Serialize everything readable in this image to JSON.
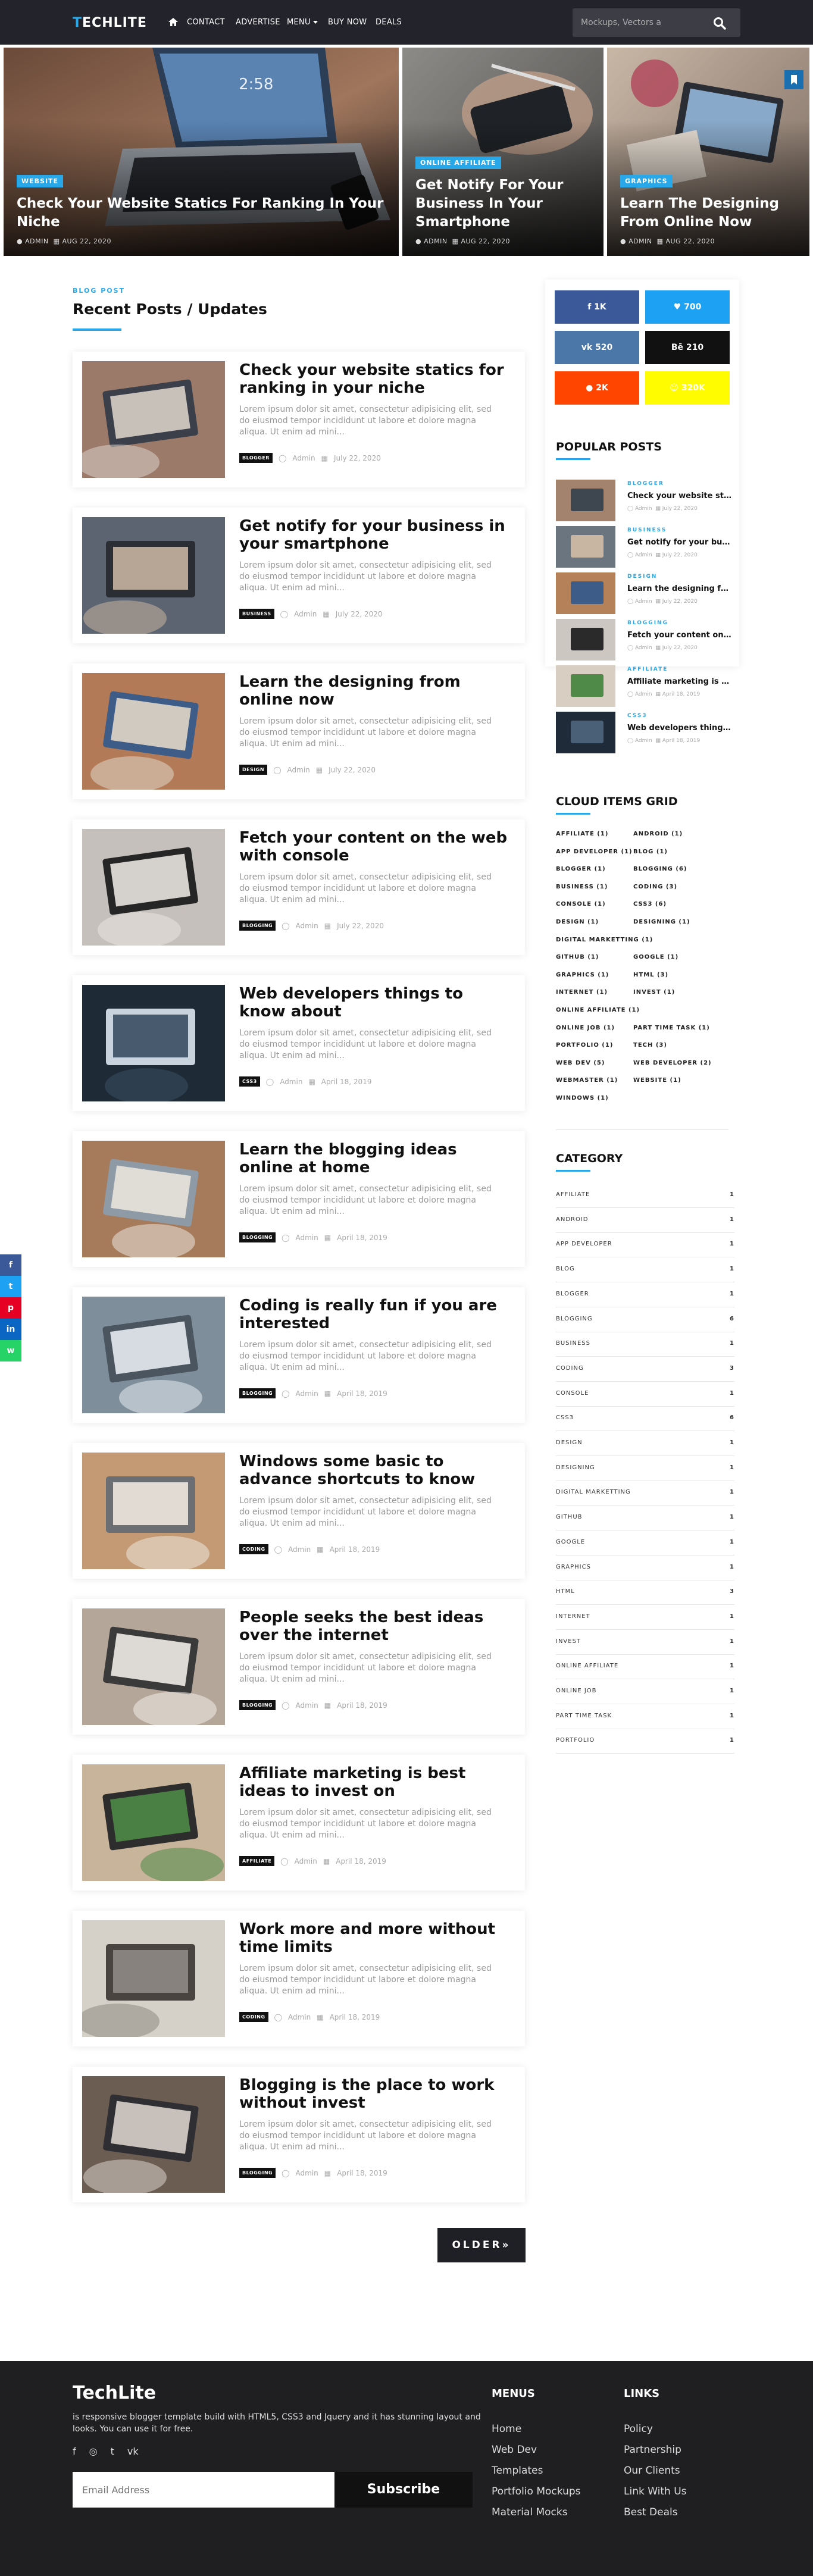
{
  "header": {
    "logo_first": "T",
    "logo_rest": "ECHLITE",
    "nav": [
      "CONTACT",
      "ADVERTISE",
      "MENU",
      "BUY NOW",
      "DEALS"
    ],
    "search_placeholder": "Mockups, Vectors a"
  },
  "hero": [
    {
      "badge": "WEBSITE",
      "title": "Check Your Website Statics For Ranking In Your Niche",
      "author": "ADMIN",
      "date": "AUG 22, 2020"
    },
    {
      "badge": "ONLINE AFFILIATE",
      "title": "Get Notify For Your Business In Your Smartphone",
      "author": "ADMIN",
      "date": "AUG 22, 2020"
    },
    {
      "badge": "GRAPHICS",
      "title": "Learn The Designing From Online Now",
      "author": "ADMIN",
      "date": "AUG 22, 2020"
    }
  ],
  "section": {
    "label": "BLOG POST",
    "title": "Recent Posts / Updates"
  },
  "posts": [
    {
      "title": "Check your website statics for ranking in your niche",
      "excerpt": "Lorem ipsum dolor sit amet, consectetur adipisicing elit, sed do eiusmod tempor incididunt ut labore et dolore magna aliqua. Ut enim ad mini...",
      "tag": "BLOGGER",
      "author": "Admin",
      "date": "July 22, 2020"
    },
    {
      "title": "Get notify for your business in your smartphone",
      "excerpt": "Lorem ipsum dolor sit amet, consectetur adipisicing elit, sed do eiusmod tempor incididunt ut labore et dolore magna aliqua. Ut enim ad mini...",
      "tag": "BUSINESS",
      "author": "Admin",
      "date": "July 22, 2020"
    },
    {
      "title": "Learn the designing from online now",
      "excerpt": "Lorem ipsum dolor sit amet, consectetur adipisicing elit, sed do eiusmod tempor incididunt ut labore et dolore magna aliqua. Ut enim ad mini...",
      "tag": "DESIGN",
      "author": "Admin",
      "date": "July 22, 2020"
    },
    {
      "title": "Fetch your content on the web with console",
      "excerpt": "Lorem ipsum dolor sit amet, consectetur adipisicing elit, sed do eiusmod tempor incididunt ut labore et dolore magna aliqua. Ut enim ad mini...",
      "tag": "BLOGGING",
      "author": "Admin",
      "date": "July 22, 2020"
    },
    {
      "title": "Web developers things to know about",
      "excerpt": "Lorem ipsum dolor sit amet, consectetur adipisicing elit, sed do eiusmod tempor incididunt ut labore et dolore magna aliqua. Ut enim ad mini...",
      "tag": "CSS3",
      "author": "Admin",
      "date": "April 18, 2019"
    },
    {
      "title": "Learn the blogging ideas online at home",
      "excerpt": "Lorem ipsum dolor sit amet, consectetur adipisicing elit, sed do eiusmod tempor incididunt ut labore et dolore magna aliqua. Ut enim ad mini...",
      "tag": "BLOGGING",
      "author": "Admin",
      "date": "April 18, 2019"
    },
    {
      "title": "Coding is really fun if you are interested",
      "excerpt": "Lorem ipsum dolor sit amet, consectetur adipisicing elit, sed do eiusmod tempor incididunt ut labore et dolore magna aliqua. Ut enim ad mini...",
      "tag": "BLOGGING",
      "author": "Admin",
      "date": "April 18, 2019"
    },
    {
      "title": "Windows some basic to advance shortcuts to know",
      "excerpt": "Lorem ipsum dolor sit amet, consectetur adipisicing elit, sed do eiusmod tempor incididunt ut labore et dolore magna aliqua. Ut enim ad mini...",
      "tag": "CODING",
      "author": "Admin",
      "date": "April 18, 2019"
    },
    {
      "title": "People seeks the best ideas over the internet",
      "excerpt": "Lorem ipsum dolor sit amet, consectetur adipisicing elit, sed do eiusmod tempor incididunt ut labore et dolore magna aliqua. Ut enim ad mini...",
      "tag": "BLOGGING",
      "author": "Admin",
      "date": "April 18, 2019"
    },
    {
      "title": "Affiliate marketing is best ideas to invest on",
      "excerpt": "Lorem ipsum dolor sit amet, consectetur adipisicing elit, sed do eiusmod tempor incididunt ut labore et dolore magna aliqua. Ut enim ad mini...",
      "tag": "AFFILIATE",
      "author": "Admin",
      "date": "April 18, 2019"
    },
    {
      "title": "Work more and more without time limits",
      "excerpt": "Lorem ipsum dolor sit amet, consectetur adipisicing elit, sed do eiusmod tempor incididunt ut labore et dolore magna aliqua. Ut enim ad mini...",
      "tag": "CODING",
      "author": "Admin",
      "date": "April 18, 2019"
    },
    {
      "title": "Blogging is the place to work without invest",
      "excerpt": "Lorem ipsum dolor sit amet, consectetur adipisicing elit, sed do eiusmod tempor incididunt ut labore et dolore magna aliqua. Ut enim ad mini...",
      "tag": "BLOGGING",
      "author": "Admin",
      "date": "April 18, 2019"
    }
  ],
  "older_label": "OLDER»",
  "social_counts": [
    {
      "label": "1K",
      "color": "#3b5998"
    },
    {
      "label": "700",
      "color": "#1da1f2"
    },
    {
      "label": "520",
      "color": "#4a76a8"
    },
    {
      "label": "210",
      "color": "#111111"
    },
    {
      "label": "2K",
      "color": "#ff4500"
    },
    {
      "label": "320K",
      "color": "#fffc00"
    }
  ],
  "popular": {
    "title": "POPULAR POSTS",
    "items": [
      {
        "cat": "BLOGGER",
        "title": "Check your website statics for ranking",
        "author": "Admin",
        "date": "July 22, 2020"
      },
      {
        "cat": "BUSINESS",
        "title": "Get notify for your business",
        "author": "Admin",
        "date": "July 22, 2020"
      },
      {
        "cat": "DESIGN",
        "title": "Learn the designing from online",
        "author": "Admin",
        "date": "July 22, 2020"
      },
      {
        "cat": "BLOGGING",
        "title": "Fetch your content on the web",
        "author": "Admin",
        "date": "July 22, 2020"
      },
      {
        "cat": "AFFILIATE",
        "title": "Affiliate marketing is best ideas",
        "author": "Admin",
        "date": "April 18, 2019"
      },
      {
        "cat": "CSS3",
        "title": "Web developers things to know",
        "author": "Admin",
        "date": "April 18, 2019"
      }
    ]
  },
  "cloud": {
    "title": "CLOUD ITEMS GRID",
    "rows": [
      [
        "AFFILIATE (1)",
        "ANDROID (1)"
      ],
      [
        "APP DEVELOPER (1)",
        "BLOG (1)"
      ],
      [
        "BLOGGER (1)",
        "BLOGGING (6)"
      ],
      [
        "BUSINESS (1)",
        "CODING (3)"
      ],
      [
        "CONSOLE (1)",
        "CSS3 (6)"
      ],
      [
        "DESIGN (1)",
        "DESIGNING (1)"
      ],
      [
        "DIGITAL MARKETTING (1)"
      ],
      [
        "GITHUB (1)",
        "GOOGLE (1)"
      ],
      [
        "GRAPHICS (1)",
        "HTML (3)"
      ],
      [
        "INTERNET (1)",
        "INVEST (1)"
      ],
      [
        "ONLINE AFFILIATE (1)"
      ],
      [
        "ONLINE JOB (1)",
        "PART TIME TASK (1)"
      ],
      [
        "PORTFOLIO (1)",
        "TECH (3)"
      ],
      [
        "WEB DEV (5)",
        "WEB DEVELOPER (2)"
      ],
      [
        "WEBMASTER (1)",
        "WEBSITE (1)"
      ],
      [
        "WINDOWS (1)"
      ]
    ]
  },
  "category": {
    "title": "CATEGORY",
    "items": [
      {
        "name": "AFFILIATE",
        "count": "1"
      },
      {
        "name": "ANDROID",
        "count": "1"
      },
      {
        "name": "APP DEVELOPER",
        "count": "1"
      },
      {
        "name": "BLOG",
        "count": "1"
      },
      {
        "name": "BLOGGER",
        "count": "1"
      },
      {
        "name": "BLOGGING",
        "count": "6"
      },
      {
        "name": "BUSINESS",
        "count": "1"
      },
      {
        "name": "CODING",
        "count": "3"
      },
      {
        "name": "CONSOLE",
        "count": "1"
      },
      {
        "name": "CSS3",
        "count": "6"
      },
      {
        "name": "DESIGN",
        "count": "1"
      },
      {
        "name": "DESIGNING",
        "count": "1"
      },
      {
        "name": "DIGITAL MARKETTING",
        "count": "1"
      },
      {
        "name": "GITHUB",
        "count": "1"
      },
      {
        "name": "GOOGLE",
        "count": "1"
      },
      {
        "name": "GRAPHICS",
        "count": "1"
      },
      {
        "name": "HTML",
        "count": "3"
      },
      {
        "name": "INTERNET",
        "count": "1"
      },
      {
        "name": "INVEST",
        "count": "1"
      },
      {
        "name": "ONLINE AFFILIATE",
        "count": "1"
      },
      {
        "name": "ONLINE JOB",
        "count": "1"
      },
      {
        "name": "PART TIME TASK",
        "count": "1"
      },
      {
        "name": "PORTFOLIO",
        "count": "1"
      }
    ]
  },
  "footer": {
    "logo": "TechLite",
    "desc": "is responsive blogger template build with HTML5, CSS3 and Jquery and it has stunning layout and looks. You can use it for free.",
    "email_placeholder": "Email Address",
    "subscribe": "Subscribe",
    "menus_title": "MENUS",
    "menus": [
      "Home",
      "Web Dev",
      "Templates",
      "Portfolio Mockups",
      "Material Mocks"
    ],
    "links_title": "LINKS",
    "links": [
      "Policy",
      "Partnership",
      "Our Clients",
      "Link With Us",
      "Best Deals"
    ]
  }
}
